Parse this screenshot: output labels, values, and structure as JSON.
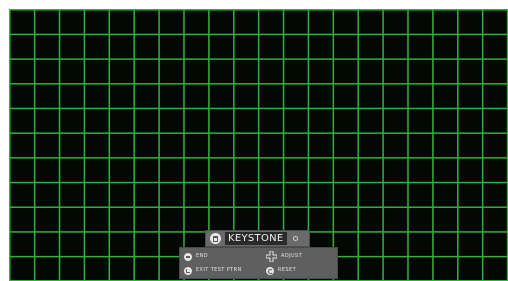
{
  "osd": {
    "title": "KEYSTONE",
    "title_icon": "keystone-icon",
    "indicator_icon": "circle-indicator-icon",
    "items": [
      {
        "icon": "end-icon",
        "label": "END"
      },
      {
        "icon": "dpad-icon",
        "label": "ADJUST"
      },
      {
        "icon": "enter-icon",
        "label": "EXIT TEST PTRN"
      },
      {
        "icon": "reset-icon",
        "label": "RESET"
      }
    ]
  },
  "colors": {
    "grid_line": "#2fb33a",
    "background": "#040804",
    "osd_panel": "#5f5f5f"
  }
}
